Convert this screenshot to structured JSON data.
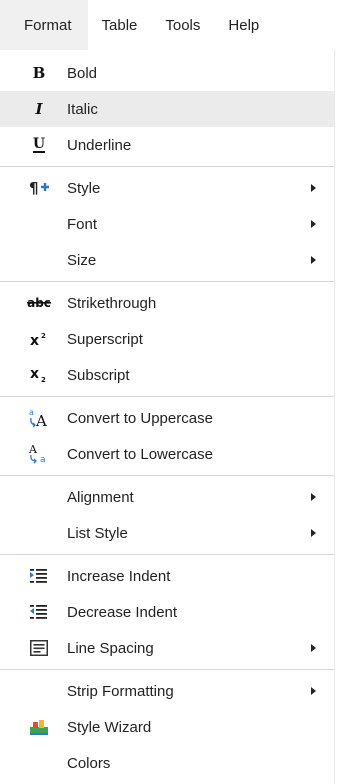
{
  "menubar": {
    "items": [
      {
        "label": "Format"
      },
      {
        "label": "Table"
      },
      {
        "label": "Tools"
      },
      {
        "label": "Help"
      }
    ]
  },
  "menu": {
    "items": [
      {
        "label": "Bold",
        "icon": "bold-icon"
      },
      {
        "label": "Italic",
        "icon": "italic-icon"
      },
      {
        "label": "Underline",
        "icon": "underline-icon"
      },
      {
        "label": "Style",
        "icon": "paragraph-style-icon"
      },
      {
        "label": "Font"
      },
      {
        "label": "Size"
      },
      {
        "label": "Strikethrough",
        "icon": "strikethrough-icon"
      },
      {
        "label": "Superscript",
        "icon": "superscript-icon"
      },
      {
        "label": "Subscript",
        "icon": "subscript-icon"
      },
      {
        "label": "Convert to Uppercase",
        "icon": "uppercase-icon"
      },
      {
        "label": "Convert to Lowercase",
        "icon": "lowercase-icon"
      },
      {
        "label": "Alignment"
      },
      {
        "label": "List Style"
      },
      {
        "label": "Increase Indent",
        "icon": "increase-indent-icon"
      },
      {
        "label": "Decrease Indent",
        "icon": "decrease-indent-icon"
      },
      {
        "label": "Line Spacing",
        "icon": "line-spacing-icon"
      },
      {
        "label": "Strip Formatting"
      },
      {
        "label": "Style Wizard",
        "icon": "style-wizard-icon"
      },
      {
        "label": "Colors"
      }
    ]
  }
}
